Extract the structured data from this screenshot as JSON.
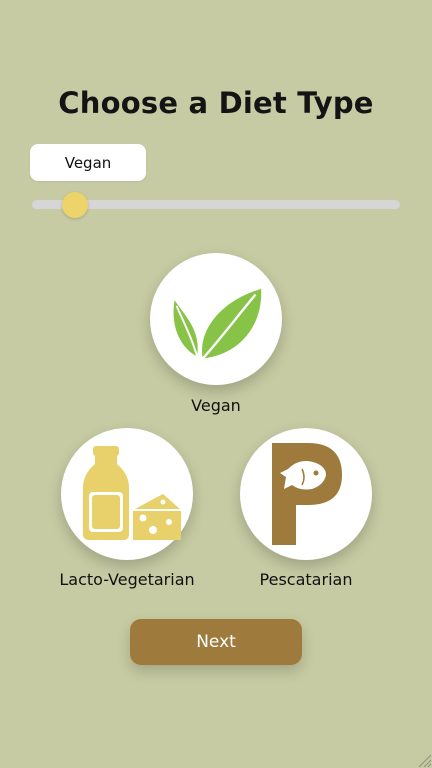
{
  "page": {
    "title": "Choose a Diet Type"
  },
  "slider": {
    "tooltip": "Vegan",
    "level": 0.1
  },
  "options": [
    {
      "label": "Vegan",
      "icon": "leaves-icon"
    },
    {
      "label": "Lacto-Vegetarian",
      "icon": "milk-cheese-icon"
    },
    {
      "label": "Pescatarian",
      "icon": "fish-p-icon"
    }
  ],
  "next_button": {
    "label": "Next"
  },
  "colors": {
    "background": "#c6cba3",
    "thumb": "#ecd46a",
    "track": "#d6d6d6",
    "button": "#9e7b3c",
    "leaf": "#86c346",
    "dairy": "#e8d06a",
    "fish_p": "#9e7b3c"
  }
}
